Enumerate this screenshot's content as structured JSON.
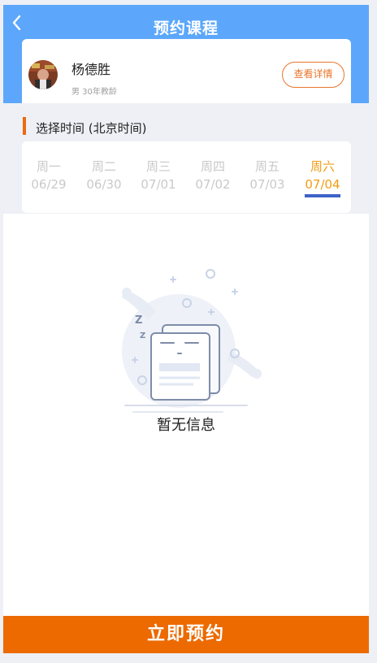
{
  "header": {
    "title": "预约课程",
    "back_icon": "chevron-left-icon"
  },
  "teacher": {
    "name": "杨德胜",
    "meta": "男 30年教龄",
    "detail_label": "查看详情"
  },
  "section": {
    "label": "选择时间 (北京时间)"
  },
  "days": [
    {
      "weekday": "周一",
      "date": "06/29",
      "active": false
    },
    {
      "weekday": "周二",
      "date": "06/30",
      "active": false
    },
    {
      "weekday": "周三",
      "date": "07/01",
      "active": false
    },
    {
      "weekday": "周四",
      "date": "07/02",
      "active": false
    },
    {
      "weekday": "周五",
      "date": "07/03",
      "active": false
    },
    {
      "weekday": "周六",
      "date": "07/04",
      "active": true
    }
  ],
  "empty": {
    "text": "暂无信息",
    "icon": "empty-documents-icon"
  },
  "footer": {
    "book_label": "立即预约"
  },
  "colors": {
    "header_blue": "#5ca7fb",
    "accent_orange": "#ec6a00",
    "active_day": "#f29c14",
    "underline_blue": "#3d63c8"
  }
}
